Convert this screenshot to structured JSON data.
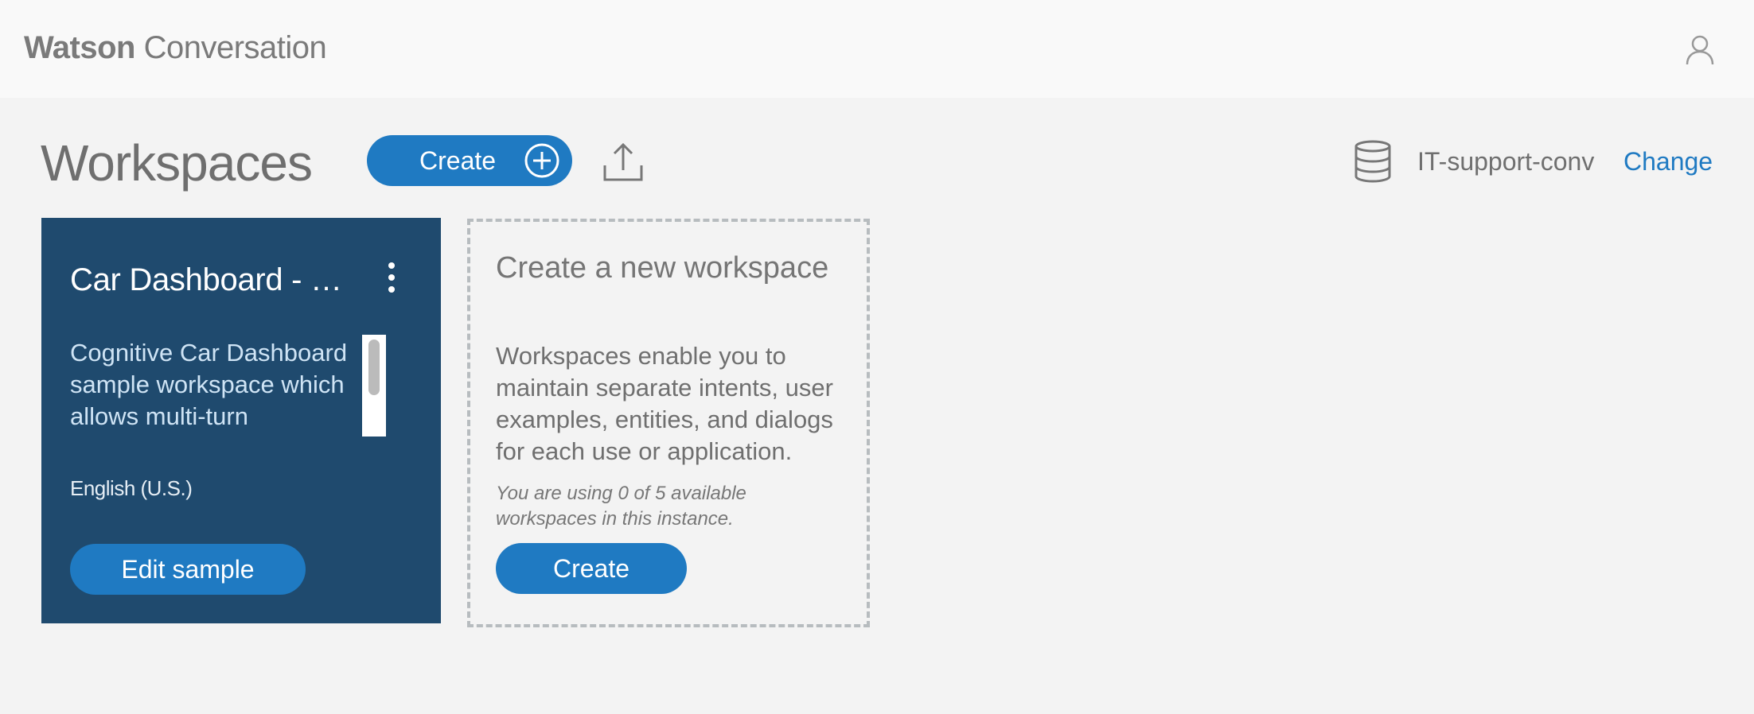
{
  "header": {
    "brand_bold": "Watson",
    "brand_light": "Conversation",
    "user_icon": "user-icon"
  },
  "toolbar": {
    "title": "Workspaces",
    "create_label": "Create",
    "create_icon": "plus-circle-icon",
    "upload_icon": "upload-icon",
    "database_icon": "database-icon",
    "instance_name": "IT-support-conv",
    "change_label": "Change"
  },
  "workspaces": [
    {
      "title": "Car Dashboard - …",
      "description": "Cognitive Car Dashboard sample workspace which allows multi-turn",
      "language": "English (U.S.)",
      "action_label": "Edit sample",
      "menu_icon": "overflow-menu-icon"
    }
  ],
  "new_workspace": {
    "title": "Create a new workspace",
    "description": "Workspaces enable you to maintain separate intents, user examples, entities, and dialogs for each use or application.",
    "usage_note": "You are using 0 of 5 available workspaces in this instance.",
    "create_label": "Create"
  },
  "colors": {
    "accent": "#1f7ac2",
    "card_background": "#1f4a6e",
    "page_background": "#f3f3f3"
  }
}
